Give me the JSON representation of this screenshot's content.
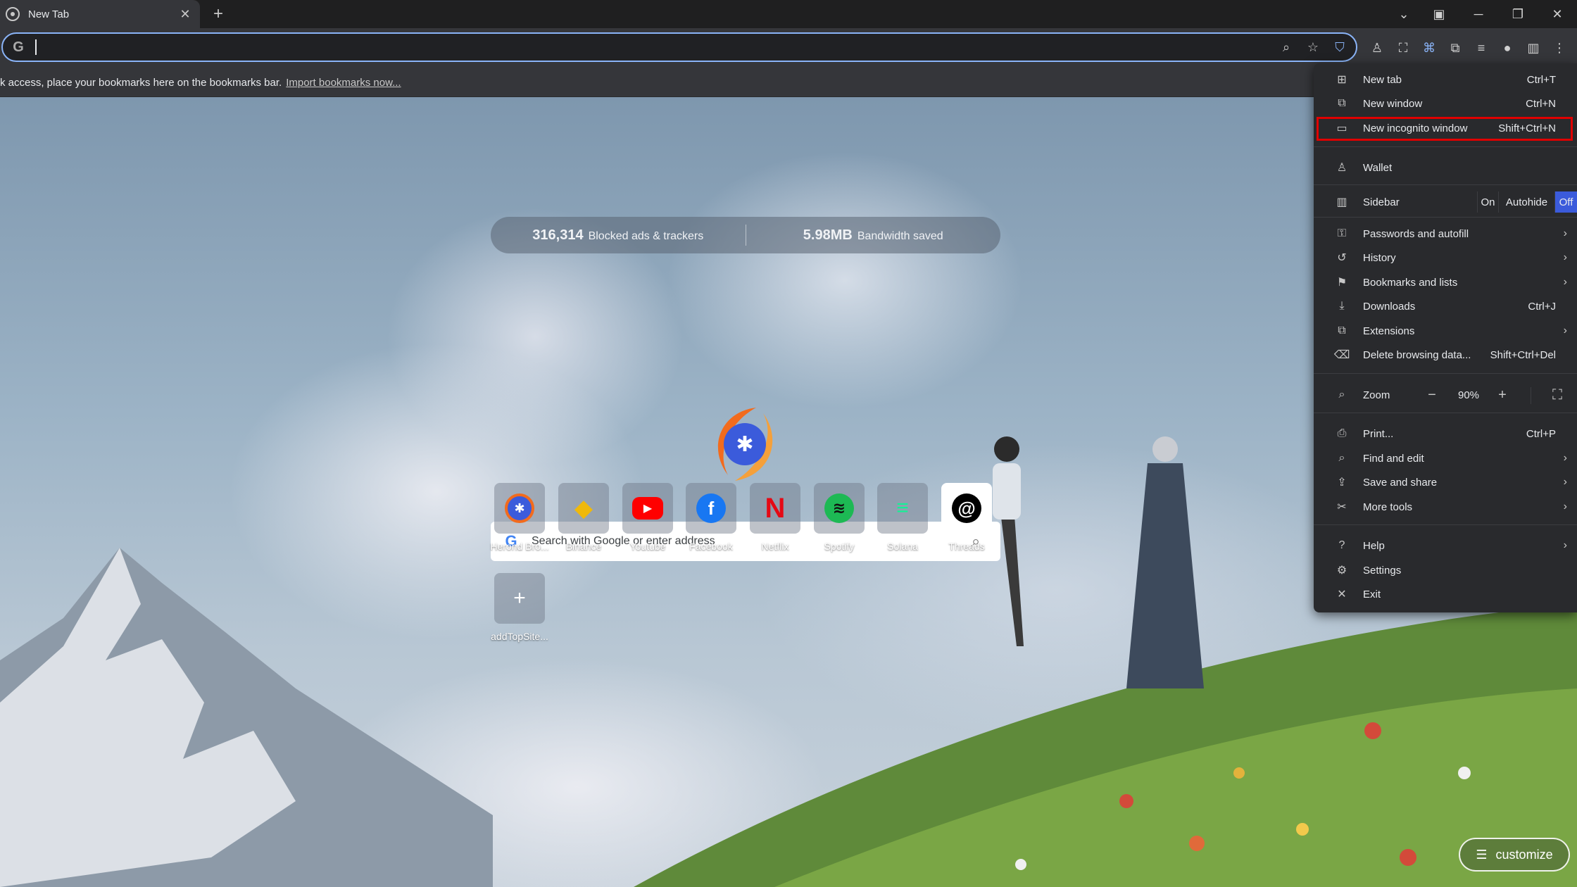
{
  "tab": {
    "title": "New Tab"
  },
  "omnibox": {
    "value": "",
    "placeholder": ""
  },
  "bookmarks_bar": {
    "text": "k access, place your bookmarks here on the bookmarks bar.",
    "link": "Import bookmarks now..."
  },
  "stats": {
    "blocked_count": "316,314",
    "blocked_label": "Blocked ads & trackers",
    "bandwidth_value": "5.98MB",
    "bandwidth_label": "Bandwidth saved"
  },
  "search": {
    "placeholder": "Search with Google or enter address"
  },
  "top_sites": [
    {
      "label": "Herond Bro...",
      "icon": "herond-icon",
      "color": "#f26b1d"
    },
    {
      "label": "Binance",
      "icon": "binance-icon",
      "color": "#f0b90b"
    },
    {
      "label": "Youtube",
      "icon": "youtube-icon",
      "color": "#ff0000"
    },
    {
      "label": "Facebook",
      "icon": "facebook-icon",
      "color": "#1877f2"
    },
    {
      "label": "Netflix",
      "icon": "netflix-icon",
      "color": "#e50914"
    },
    {
      "label": "Spotify",
      "icon": "spotify-icon",
      "color": "#1db954"
    },
    {
      "label": "Solana",
      "icon": "solana-icon",
      "color": "#9945ff"
    },
    {
      "label": "Threads",
      "icon": "threads-icon",
      "color": "#000000"
    }
  ],
  "add_site": {
    "label": "addTopSite..."
  },
  "customize": {
    "label": "customize"
  },
  "menu": {
    "new_tab": {
      "label": "New tab",
      "shortcut": "Ctrl+T"
    },
    "new_window": {
      "label": "New window",
      "shortcut": "Ctrl+N"
    },
    "new_incognito": {
      "label": "New incognito window",
      "shortcut": "Shift+Ctrl+N"
    },
    "wallet": {
      "label": "Wallet"
    },
    "sidebar": {
      "label": "Sidebar",
      "options": [
        "On",
        "Autohide",
        "Off"
      ],
      "selected": "Off"
    },
    "passwords": {
      "label": "Passwords and autofill"
    },
    "history": {
      "label": "History"
    },
    "bookmarks": {
      "label": "Bookmarks and lists"
    },
    "downloads": {
      "label": "Downloads",
      "shortcut": "Ctrl+J"
    },
    "extensions": {
      "label": "Extensions"
    },
    "delete_data": {
      "label": "Delete browsing data...",
      "shortcut": "Shift+Ctrl+Del"
    },
    "zoom": {
      "label": "Zoom",
      "value": "90%",
      "minus": "−",
      "plus": "+"
    },
    "print": {
      "label": "Print...",
      "shortcut": "Ctrl+P"
    },
    "find_edit": {
      "label": "Find and edit"
    },
    "save_share": {
      "label": "Save and share"
    },
    "more_tools": {
      "label": "More tools"
    },
    "help": {
      "label": "Help"
    },
    "settings": {
      "label": "Settings"
    },
    "exit": {
      "label": "Exit"
    }
  },
  "colors": {
    "accent": "#8ab4f8",
    "highlight": "#e00000",
    "sidebar_selected": "#3b5bdb"
  }
}
